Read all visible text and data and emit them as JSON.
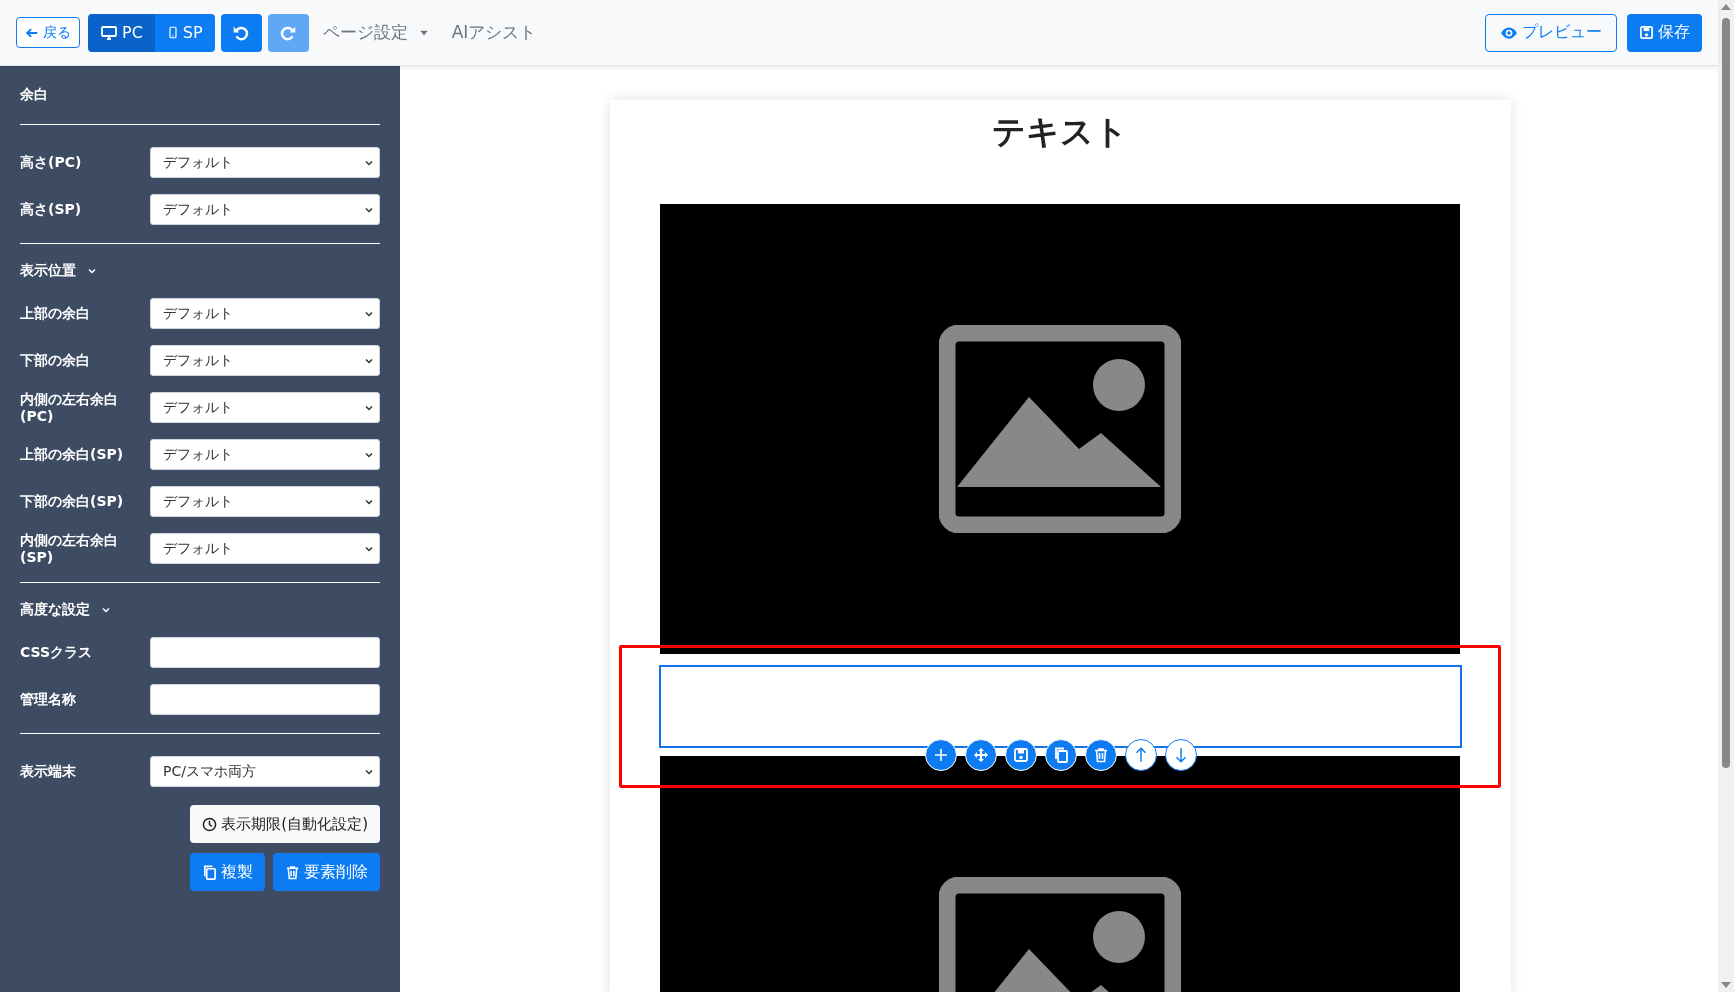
{
  "toolbar": {
    "back": "戻る",
    "devices": [
      {
        "label": "PC",
        "kind": "pc",
        "selected": true
      },
      {
        "label": "SP",
        "kind": "sp",
        "selected": false
      }
    ],
    "undo": {
      "disabled": false
    },
    "redo": {
      "disabled": true
    },
    "page_settings": "ページ設定",
    "ai_assist": "AIアシスト",
    "preview": "プレビュー",
    "save": "保存"
  },
  "sidebar": {
    "sections": [
      {
        "title": "余白",
        "collapsible": false,
        "fields": [
          {
            "label": "高さ(PC)",
            "kind": "select",
            "value": "デフォルト"
          },
          {
            "label": "高さ(SP)",
            "kind": "select",
            "value": "デフォルト"
          }
        ]
      },
      {
        "title": "表示位置",
        "collapsible": true,
        "fields": [
          {
            "label": "上部の余白",
            "kind": "select",
            "value": "デフォルト"
          },
          {
            "label": "下部の余白",
            "kind": "select",
            "value": "デフォルト"
          },
          {
            "label": "内側の左右余白(PC)",
            "kind": "select",
            "value": "デフォルト"
          },
          {
            "label": "上部の余白(SP)",
            "kind": "select",
            "value": "デフォルト"
          },
          {
            "label": "下部の余白(SP)",
            "kind": "select",
            "value": "デフォルト"
          },
          {
            "label": "内側の左右余白(SP)",
            "kind": "select",
            "value": "デフォルト"
          }
        ]
      },
      {
        "title": "高度な設定",
        "collapsible": true,
        "fields": [
          {
            "label": "CSSクラス",
            "kind": "input"
          },
          {
            "label": "管理名称",
            "kind": "input"
          }
        ]
      },
      {
        "fields": [
          {
            "label": "表示端末",
            "kind": "select",
            "value": "PC/スマホ両方"
          }
        ]
      }
    ],
    "schedule_button": "表示期限(自動化設定)",
    "duplicate_button": "複製",
    "delete_button": "要素削除"
  },
  "canvas": {
    "title": "テキスト",
    "blocks": [
      {
        "kind": "image",
        "selected": false
      },
      {
        "kind": "spacer",
        "selected": true
      },
      {
        "kind": "image",
        "selected": false
      }
    ],
    "element_tools": [
      {
        "kind": "add"
      },
      {
        "kind": "move"
      },
      {
        "kind": "save"
      },
      {
        "kind": "copy"
      },
      {
        "kind": "delete"
      },
      {
        "kind": "up"
      },
      {
        "kind": "down"
      }
    ]
  }
}
